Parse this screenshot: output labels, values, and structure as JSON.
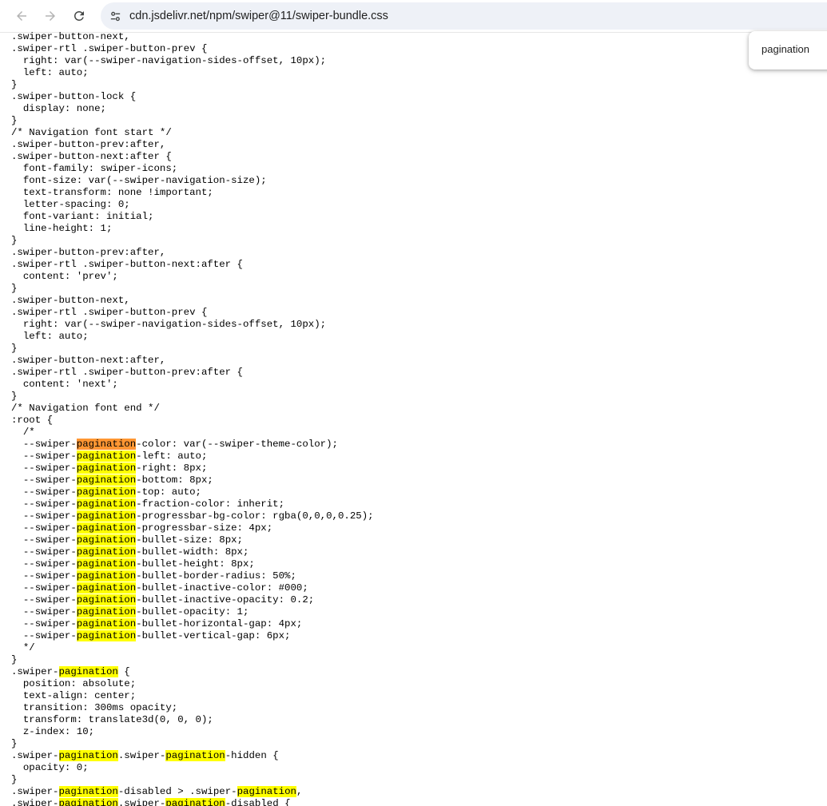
{
  "browser": {
    "url": "cdn.jsdelivr.net/npm/swiper@11/swiper-bundle.css",
    "back_icon": "arrow-left-icon",
    "forward_icon": "arrow-right-icon",
    "reload_icon": "reload-icon",
    "site_info_icon": "tune-icon"
  },
  "find_bar": {
    "query": "pagination"
  },
  "colors": {
    "match_highlight": "#ffff00",
    "active_match_highlight": "#ff9632"
  },
  "code": {
    "lines": [
      [
        ".swiper-button-next,"
      ],
      [
        ".swiper-rtl .swiper-button-prev {"
      ],
      [
        "  right: var(--swiper-navigation-sides-offset, 10px);"
      ],
      [
        "  left: auto;"
      ],
      [
        "}"
      ],
      [
        ".swiper-button-lock {"
      ],
      [
        "  display: none;"
      ],
      [
        "}"
      ],
      [
        "/* Navigation font start */"
      ],
      [
        ".swiper-button-prev:after,"
      ],
      [
        ".swiper-button-next:after {"
      ],
      [
        "  font-family: swiper-icons;"
      ],
      [
        "  font-size: var(--swiper-navigation-size);"
      ],
      [
        "  text-transform: none !important;"
      ],
      [
        "  letter-spacing: 0;"
      ],
      [
        "  font-variant: initial;"
      ],
      [
        "  line-height: 1;"
      ],
      [
        "}"
      ],
      [
        ".swiper-button-prev:after,"
      ],
      [
        ".swiper-rtl .swiper-button-next:after {"
      ],
      [
        "  content: 'prev';"
      ],
      [
        "}"
      ],
      [
        ".swiper-button-next,"
      ],
      [
        ".swiper-rtl .swiper-button-prev {"
      ],
      [
        "  right: var(--swiper-navigation-sides-offset, 10px);"
      ],
      [
        "  left: auto;"
      ],
      [
        "}"
      ],
      [
        ".swiper-button-next:after,"
      ],
      [
        ".swiper-rtl .swiper-button-prev:after {"
      ],
      [
        "  content: 'next';"
      ],
      [
        "}"
      ],
      [
        "/* Navigation font end */"
      ],
      [
        ":root {"
      ],
      [
        "  /*"
      ],
      [
        "  --swiper-",
        "pagination*",
        "-color: var(--swiper-theme-color);"
      ],
      [
        "  --swiper-",
        "pagination",
        "-left: auto;"
      ],
      [
        "  --swiper-",
        "pagination",
        "-right: 8px;"
      ],
      [
        "  --swiper-",
        "pagination",
        "-bottom: 8px;"
      ],
      [
        "  --swiper-",
        "pagination",
        "-top: auto;"
      ],
      [
        "  --swiper-",
        "pagination",
        "-fraction-color: inherit;"
      ],
      [
        "  --swiper-",
        "pagination",
        "-progressbar-bg-color: rgba(0,0,0,0.25);"
      ],
      [
        "  --swiper-",
        "pagination",
        "-progressbar-size: 4px;"
      ],
      [
        "  --swiper-",
        "pagination",
        "-bullet-size: 8px;"
      ],
      [
        "  --swiper-",
        "pagination",
        "-bullet-width: 8px;"
      ],
      [
        "  --swiper-",
        "pagination",
        "-bullet-height: 8px;"
      ],
      [
        "  --swiper-",
        "pagination",
        "-bullet-border-radius: 50%;"
      ],
      [
        "  --swiper-",
        "pagination",
        "-bullet-inactive-color: #000;"
      ],
      [
        "  --swiper-",
        "pagination",
        "-bullet-inactive-opacity: 0.2;"
      ],
      [
        "  --swiper-",
        "pagination",
        "-bullet-opacity: 1;"
      ],
      [
        "  --swiper-",
        "pagination",
        "-bullet-horizontal-gap: 4px;"
      ],
      [
        "  --swiper-",
        "pagination",
        "-bullet-vertical-gap: 6px;"
      ],
      [
        "  */"
      ],
      [
        "}"
      ],
      [
        ".swiper-",
        "pagination",
        " {"
      ],
      [
        "  position: absolute;"
      ],
      [
        "  text-align: center;"
      ],
      [
        "  transition: 300ms opacity;"
      ],
      [
        "  transform: translate3d(0, 0, 0);"
      ],
      [
        "  z-index: 10;"
      ],
      [
        "}"
      ],
      [
        ".swiper-",
        "pagination",
        ".swiper-",
        "pagination",
        "-hidden {"
      ],
      [
        "  opacity: 0;"
      ],
      [
        "}"
      ],
      [
        ".swiper-",
        "pagination",
        "-disabled > .swiper-",
        "pagination",
        ","
      ],
      [
        ".swiper-",
        "pagination",
        ".swiper-",
        "pagination",
        "-disabled {"
      ]
    ]
  }
}
